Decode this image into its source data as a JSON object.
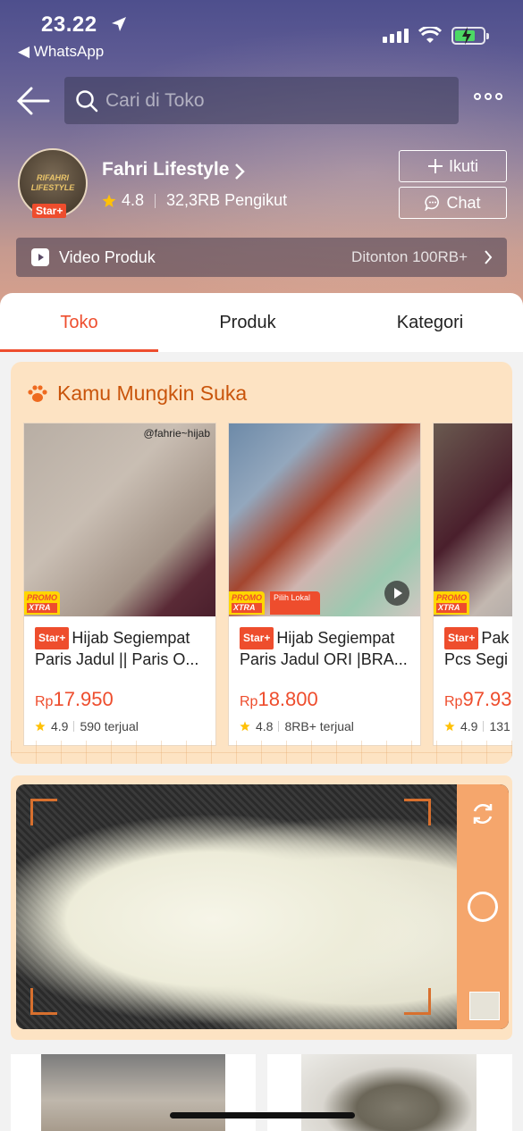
{
  "status_bar": {
    "time": "23.22",
    "back_app": "◀ WhatsApp",
    "signal_bars": 4,
    "battery_charging": true
  },
  "nav": {
    "search_placeholder": "Cari di Toko"
  },
  "shop": {
    "name": "Fahri Lifestyle",
    "logo_text": "RIFAHRI LIFESTYLE",
    "badge": "Star+",
    "rating": "4.8",
    "followers": "32,3RB Pengikut",
    "follow_label": "Ikuti",
    "chat_label": "Chat"
  },
  "video_bar": {
    "label": "Video Produk",
    "views": "Ditonton 100RB+"
  },
  "tabs": [
    {
      "label": "Toko",
      "active": true
    },
    {
      "label": "Produk",
      "active": false
    },
    {
      "label": "Kategori",
      "active": false
    }
  ],
  "recommendations": {
    "title": "Kamu Mungkin Suka",
    "items": [
      {
        "watermark": "@fahrie~hijab",
        "badge": "Star+",
        "name": "Hijab Segiempat Paris Jadul || Paris O...",
        "currency": "Rp",
        "price": "17.950",
        "rating": "4.9",
        "sold": "590 terjual",
        "promo_top": "PROMO",
        "promo_bottom": "XTRA"
      },
      {
        "badge": "Star+",
        "name": "Hijab Segiempat Paris Jadul ORI |BRA...",
        "currency": "Rp",
        "price": "18.800",
        "rating": "4.8",
        "sold": "8RB+ terjual",
        "promo_top": "PROMO",
        "promo_bottom": "XTRA",
        "local_label": "Pilih Lokal",
        "has_video": true
      },
      {
        "badge": "Star+",
        "name": "Pak Pcs Segi",
        "currency": "Rp",
        "price": "97.93",
        "rating": "4.9",
        "sold": "131",
        "promo_top": "PROMO",
        "promo_bottom": "XTRA"
      }
    ]
  },
  "colors": {
    "accent": "#ee4d2d",
    "section_bg": "#fde3c3",
    "camera_side": "#f5a66c"
  },
  "icons": {
    "back": "arrow-left-icon",
    "search": "search-icon",
    "more": "more-dots-icon",
    "follow": "plus-icon",
    "chat": "chat-bubble-icon",
    "video": "shop-video-icon",
    "paw": "paw-icon",
    "rotate": "camera-rotate-icon"
  }
}
